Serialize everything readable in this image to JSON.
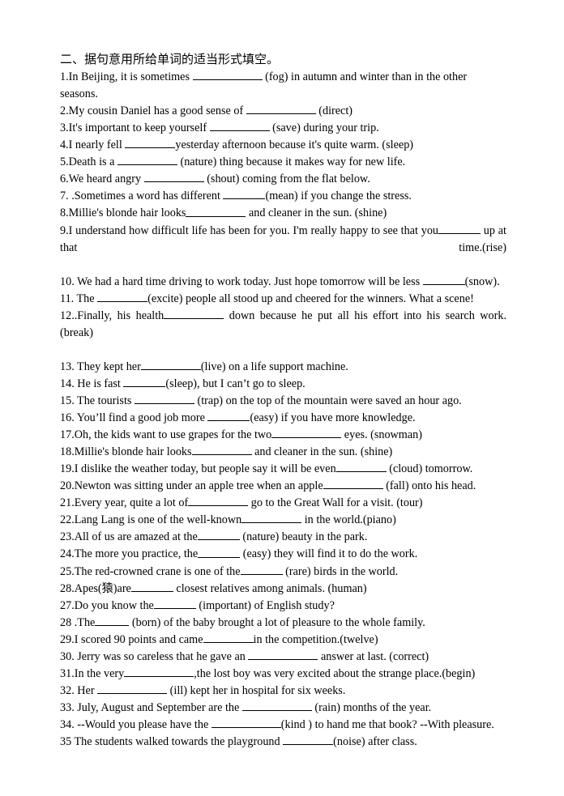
{
  "document": {
    "heading": "二、据句意用所给单词的适当形式填空。",
    "items": [
      {
        "number": "1.",
        "segments": [
          {
            "type": "text",
            "value": "In Beijing, it is sometimes "
          },
          {
            "type": "blank",
            "size": "b-xl"
          },
          {
            "type": "text",
            "value": " (fog) in autumn and winter than in the other seasons."
          }
        ],
        "justified": false
      },
      {
        "number": "2.",
        "segments": [
          {
            "type": "text",
            "value": "My cousin Daniel has a good sense of "
          },
          {
            "type": "blank",
            "size": "b-xl"
          },
          {
            "type": "text",
            "value": " (direct)"
          }
        ],
        "justified": false
      },
      {
        "number": "3.",
        "segments": [
          {
            "type": "text",
            "value": "It's important to keep yourself "
          },
          {
            "type": "blank",
            "size": "b-l"
          },
          {
            "type": "text",
            "value": " (save) during your trip."
          }
        ],
        "justified": false
      },
      {
        "number": "4.",
        "segments": [
          {
            "type": "text",
            "value": "I nearly fell "
          },
          {
            "type": "blank",
            "size": "b-m"
          },
          {
            "type": "text",
            "value": "yesterday afternoon because it's quite warm. (sleep)"
          }
        ],
        "justified": false
      },
      {
        "number": "5.",
        "segments": [
          {
            "type": "text",
            "value": "Death is a "
          },
          {
            "type": "blank",
            "size": "b-l"
          },
          {
            "type": "text",
            "value": " (nature) thing because it makes way for new life."
          }
        ],
        "justified": false
      },
      {
        "number": "6.",
        "segments": [
          {
            "type": "text",
            "value": "We heard angry "
          },
          {
            "type": "blank",
            "size": "b-l"
          },
          {
            "type": "text",
            "value": " (shout) coming from the flat below."
          }
        ],
        "justified": false
      },
      {
        "number": "7. .",
        "segments": [
          {
            "type": "text",
            "value": "Sometimes a word has different "
          },
          {
            "type": "blank",
            "size": "b-s"
          },
          {
            "type": "text",
            "value": "(mean) if you change the stress."
          }
        ],
        "justified": false
      },
      {
        "number": "8.",
        "segments": [
          {
            "type": "text",
            "value": "Millie's blonde hair looks"
          },
          {
            "type": "blank",
            "size": "b-l"
          },
          {
            "type": "text",
            "value": " and cleaner in the sun. (shine)"
          }
        ],
        "justified": false
      },
      {
        "number": "9.",
        "segments": [
          {
            "type": "text",
            "value": "I understand how difficult life has been for you. I'm really happy to see that you"
          },
          {
            "type": "blank",
            "size": "b-s"
          },
          {
            "type": "text",
            "value": " up at that time.(rise)"
          }
        ],
        "justified": true
      },
      {
        "number": "10. ",
        "segments": [
          {
            "type": "text",
            "value": "We had a hard time driving to work today. Just hope tomorrow will be less "
          },
          {
            "type": "blank",
            "size": "b-s"
          },
          {
            "type": "text",
            "value": "(snow)."
          }
        ],
        "justified": false
      },
      {
        "number": "11. ",
        "segments": [
          {
            "type": "text",
            "value": "The "
          },
          {
            "type": "blank",
            "size": "b-m"
          },
          {
            "type": "text",
            "value": "(excite) people all stood up and cheered for the winners. What a scene!"
          }
        ],
        "justified": false
      },
      {
        "number": "12..",
        "segments": [
          {
            "type": "text",
            "value": "Finally, his health"
          },
          {
            "type": "blank",
            "size": "b-l"
          },
          {
            "type": "text",
            "value": " down because he put all his effort into his search work. (break)"
          }
        ],
        "justified": true
      },
      {
        "number": "13. ",
        "segments": [
          {
            "type": "text",
            "value": "They kept her"
          },
          {
            "type": "blank",
            "size": "b-l"
          },
          {
            "type": "text",
            "value": "(live) on a life support machine."
          }
        ],
        "justified": false
      },
      {
        "number": "14. ",
        "segments": [
          {
            "type": "text",
            "value": "He is fast "
          },
          {
            "type": "blank",
            "size": "b-s"
          },
          {
            "type": "text",
            "value": "(sleep), but I can’t go to sleep."
          }
        ],
        "justified": false
      },
      {
        "number": "15. ",
        "segments": [
          {
            "type": "text",
            "value": "The tourists "
          },
          {
            "type": "blank",
            "size": "b-l"
          },
          {
            "type": "text",
            "value": " (trap) on the top of the mountain were saved an hour ago."
          }
        ],
        "justified": false
      },
      {
        "number": "16. ",
        "segments": [
          {
            "type": "text",
            "value": "You’ll find a good job more "
          },
          {
            "type": "blank",
            "size": "b-s"
          },
          {
            "type": "text",
            "value": "(easy) if you have more knowledge."
          }
        ],
        "justified": false
      },
      {
        "number": "17.",
        "segments": [
          {
            "type": "text",
            "value": "Oh, the kids want to use grapes for the two"
          },
          {
            "type": "blank",
            "size": "b-xl"
          },
          {
            "type": "text",
            "value": " eyes. (snowman)"
          }
        ],
        "justified": false
      },
      {
        "number": "18.",
        "segments": [
          {
            "type": "text",
            "value": "Millie's blonde hair looks"
          },
          {
            "type": "blank",
            "size": "b-l"
          },
          {
            "type": "text",
            "value": " and cleaner in the sun. (shine)"
          }
        ],
        "justified": false
      },
      {
        "number": "19.",
        "segments": [
          {
            "type": "text",
            "value": "I dislike the weather today, but people say it will be even"
          },
          {
            "type": "blank",
            "size": "b-m"
          },
          {
            "type": "text",
            "value": " (cloud) tomorrow."
          }
        ],
        "justified": false
      },
      {
        "number": "20.",
        "segments": [
          {
            "type": "text",
            "value": "Newton was sitting under an apple tree when an apple"
          },
          {
            "type": "blank",
            "size": "b-l"
          },
          {
            "type": "text",
            "value": " (fall) onto his head."
          }
        ],
        "justified": false
      },
      {
        "number": "21.",
        "segments": [
          {
            "type": "text",
            "value": "Every year, quite a lot of"
          },
          {
            "type": "blank",
            "size": "b-l"
          },
          {
            "type": "text",
            "value": " go to the Great Wall for a visit. (tour)"
          }
        ],
        "justified": false
      },
      {
        "number": "22.",
        "segments": [
          {
            "type": "text",
            "value": "Lang Lang is one of the well-known"
          },
          {
            "type": "blank",
            "size": "b-l"
          },
          {
            "type": "text",
            "value": " in the world.(piano)"
          }
        ],
        "justified": false
      },
      {
        "number": "23.",
        "segments": [
          {
            "type": "text",
            "value": "All of us are amazed at the"
          },
          {
            "type": "blank",
            "size": "b-s"
          },
          {
            "type": "text",
            "value": " (nature) beauty in the park."
          }
        ],
        "justified": false
      },
      {
        "number": "24.",
        "segments": [
          {
            "type": "text",
            "value": "The more you practice, the"
          },
          {
            "type": "blank",
            "size": "b-s"
          },
          {
            "type": "text",
            "value": " (easy) they will find it to do the work."
          }
        ],
        "justified": false
      },
      {
        "number": "25.",
        "segments": [
          {
            "type": "text",
            "value": "The red-crowned crane is one of the"
          },
          {
            "type": "blank",
            "size": "b-s"
          },
          {
            "type": "text",
            "value": " (rare) birds in the world."
          }
        ],
        "justified": false
      },
      {
        "number": "28.",
        "segments": [
          {
            "type": "text",
            "value": "Apes(猿)are"
          },
          {
            "type": "blank",
            "size": "b-s"
          },
          {
            "type": "text",
            "value": " closest relatives among animals. (human)"
          }
        ],
        "justified": false
      },
      {
        "number": "27.",
        "segments": [
          {
            "type": "text",
            "value": "Do you know the"
          },
          {
            "type": "blank",
            "size": "b-s"
          },
          {
            "type": "text",
            "value": " (important) of English study?"
          }
        ],
        "justified": false
      },
      {
        "number": "28 .",
        "segments": [
          {
            "type": "text",
            "value": "The"
          },
          {
            "type": "blank",
            "size": "b-xs"
          },
          {
            "type": "text",
            "value": " (born) of the baby brought a lot of pleasure to the whole family."
          }
        ],
        "justified": false
      },
      {
        "number": "29.",
        "segments": [
          {
            "type": "text",
            "value": "I scored 90 points and came"
          },
          {
            "type": "blank",
            "size": "b-m"
          },
          {
            "type": "text",
            "value": "in the competition.(twelve)"
          }
        ],
        "justified": false
      },
      {
        "number": "30. ",
        "segments": [
          {
            "type": "text",
            "value": "Jerry was so careless that he gave an "
          },
          {
            "type": "blank",
            "size": "b-xl"
          },
          {
            "type": "text",
            "value": " answer at last. (correct)"
          }
        ],
        "justified": false
      },
      {
        "number": "31.",
        "segments": [
          {
            "type": "text",
            "value": "In the very"
          },
          {
            "type": "blank",
            "size": "b-xl"
          },
          {
            "type": "text",
            "value": ",the lost boy was very excited about the strange place.(begin)"
          }
        ],
        "justified": false
      },
      {
        "number": "32. ",
        "segments": [
          {
            "type": "text",
            "value": "Her "
          },
          {
            "type": "blank",
            "size": "b-xl"
          },
          {
            "type": "text",
            "value": " (ill) kept her in hospital for six weeks."
          }
        ],
        "justified": false
      },
      {
        "number": "33. ",
        "segments": [
          {
            "type": "text",
            "value": "July, August and September are the "
          },
          {
            "type": "blank",
            "size": "b-xl"
          },
          {
            "type": "text",
            "value": " (rain) months of the year."
          }
        ],
        "justified": false
      },
      {
        "number": "34. ",
        "segments": [
          {
            "type": "text",
            "value": "--Would you please have the "
          },
          {
            "type": "blank",
            "size": "b-xl"
          },
          {
            "type": "text",
            "value": "(kind ) to hand me that book?    --With pleasure."
          }
        ],
        "justified": false
      },
      {
        "number": "35 ",
        "segments": [
          {
            "type": "text",
            "value": "The students walked towards the playground "
          },
          {
            "type": "blank",
            "size": "b-m"
          },
          {
            "type": "text",
            "value": "(noise) after class."
          }
        ],
        "justified": false
      }
    ]
  }
}
